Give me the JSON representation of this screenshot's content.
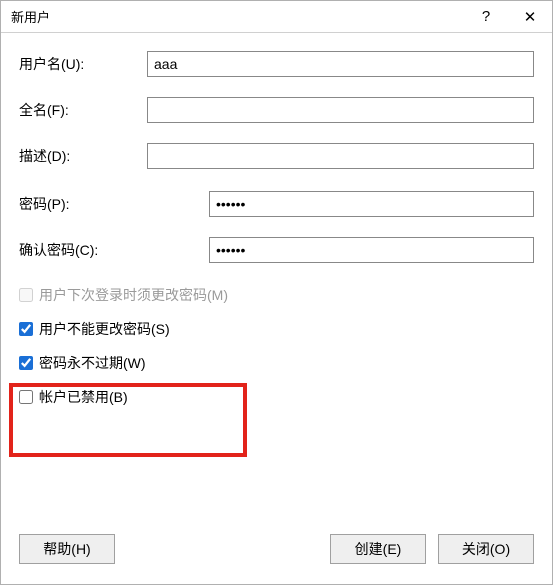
{
  "title": "新用户",
  "labels": {
    "username": "用户名(U):",
    "fullname": "全名(F):",
    "description": "描述(D):",
    "password": "密码(P):",
    "confirm_password": "确认密码(C):"
  },
  "values": {
    "username": "aaa",
    "fullname": "",
    "description": "",
    "password": "••••••",
    "confirm_password": "••••••"
  },
  "checks": {
    "must_change_next_logon": {
      "label": "用户下次登录时须更改密码(M)",
      "checked": false,
      "disabled": true
    },
    "cannot_change": {
      "label": "用户不能更改密码(S)",
      "checked": true,
      "disabled": false
    },
    "never_expires": {
      "label": "密码永不过期(W)",
      "checked": true,
      "disabled": false
    },
    "disabled_account": {
      "label": "帐户已禁用(B)",
      "checked": false,
      "disabled": false
    }
  },
  "buttons": {
    "help": "帮助(H)",
    "create": "创建(E)",
    "close": "关闭(O)"
  },
  "titlebar_icons": {
    "help": "?",
    "close": "✕"
  }
}
